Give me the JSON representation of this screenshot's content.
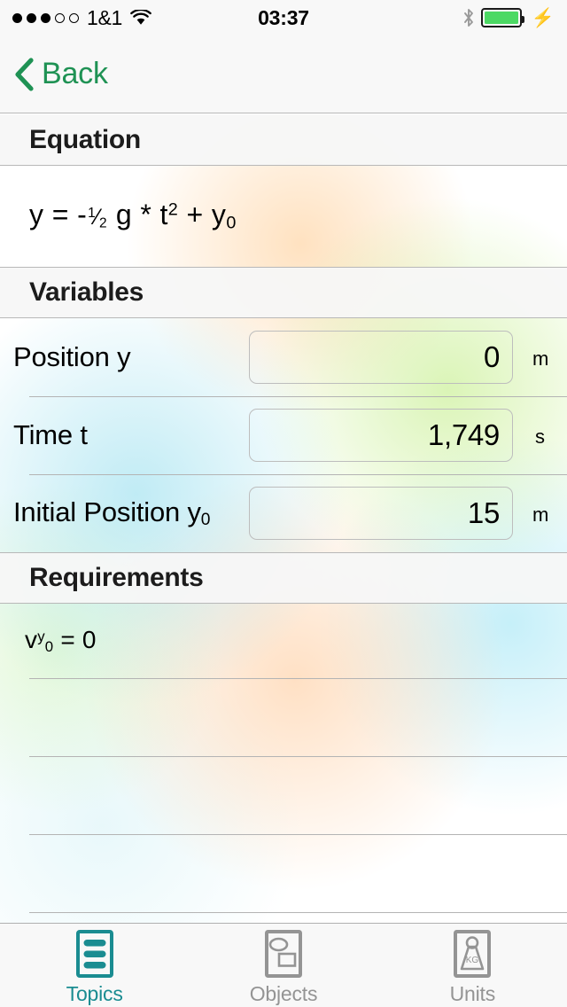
{
  "status_bar": {
    "signal_dots_filled": 3,
    "signal_dots_total": 5,
    "carrier": "1&1",
    "wifi_icon": "wifi-icon",
    "time": "03:37",
    "bluetooth_icon": "bluetooth-icon",
    "battery_icon": "battery-icon",
    "battery_level_percent": 100,
    "battery_color": "#4cd964",
    "charging_icon": "lightning-bolt-icon"
  },
  "nav_bar": {
    "back_label": "Back",
    "back_chevron_icon": "chevron-left-icon",
    "accent_color": "#1f9254"
  },
  "sections": {
    "equation": {
      "header": "Equation",
      "formula_plain": "y = -½ g * t² + y₀",
      "lhs": "y",
      "equals": "=",
      "minus": "-",
      "fraction_numerator": "1",
      "fraction_slash": "⁄",
      "fraction_denominator": "2",
      "gravity": "g",
      "times": "*",
      "time_var": "t",
      "time_exponent": "2",
      "plus": "+",
      "initial_var": "y",
      "initial_sub": "0"
    },
    "variables": {
      "header": "Variables",
      "rows": [
        {
          "label": "Position y",
          "label_base": "Position y",
          "label_sub": "",
          "value": "0",
          "unit": "m"
        },
        {
          "label": "Time t",
          "label_base": "Time t",
          "label_sub": "",
          "value": "1,749",
          "unit": "s"
        },
        {
          "label": "Initial Position y0",
          "label_base": "Initial Position y",
          "label_sub": "0",
          "value": "15",
          "unit": "m"
        }
      ]
    },
    "requirements": {
      "header": "Requirements",
      "rows": [
        {
          "base": "v",
          "sup": "y",
          "sub": "0",
          "rest": " = 0",
          "plain": "vʸ₀ = 0"
        }
      ],
      "empty_rows": 4
    }
  },
  "tab_bar": {
    "active_color": "#1a8c91",
    "inactive_color": "#949494",
    "tabs": [
      {
        "label": "Topics",
        "icon": "list-lines-icon",
        "active": true
      },
      {
        "label": "Objects",
        "icon": "shapes-icon",
        "active": false
      },
      {
        "label": "Units",
        "icon": "weight-kg-icon",
        "active": false
      }
    ]
  }
}
